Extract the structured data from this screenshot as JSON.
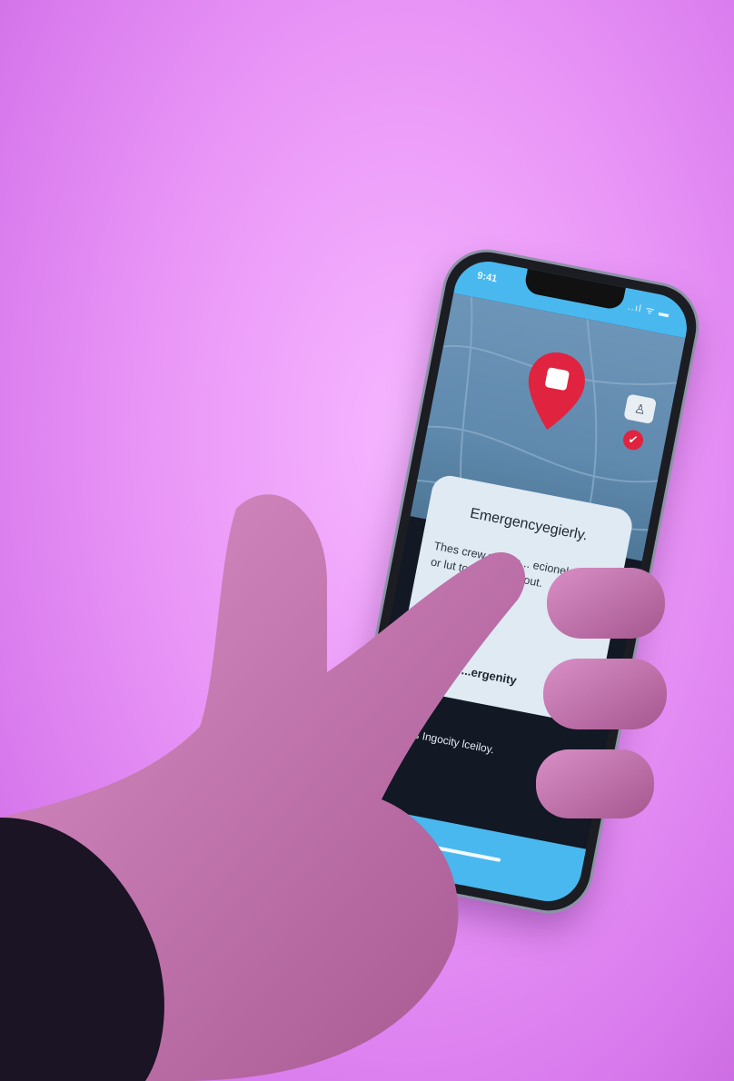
{
  "phone": {
    "status_time": "9:41",
    "status_icons": "..ıl ᯤ ▬",
    "map": {
      "pin_icon": "location-pin-icon",
      "pin_color": "#e0233f",
      "profile_button_icon": "person-icon",
      "check_badge_icon": "check-icon"
    },
    "card": {
      "title": "Emergencyegierly.",
      "body_line1": "Thes crew wsat e... ecionel",
      "body_line2": "or lut to go tr... me out.",
      "subtitle": "...ergenity"
    },
    "hint_text": "...s Ingocity lceiloy."
  },
  "colors": {
    "background": "#e995f7",
    "screen_accent": "#49b8ee",
    "card": "#dfeaf3"
  }
}
